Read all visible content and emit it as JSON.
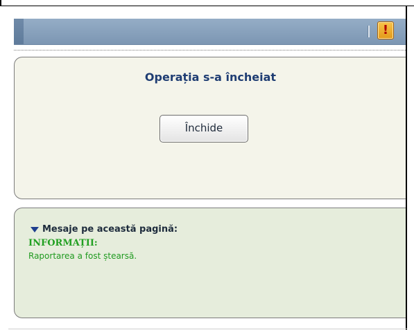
{
  "header": {
    "alert_icon": "exclamation-icon",
    "alert_glyph": "!"
  },
  "main": {
    "title": "Operația s-a încheiat",
    "close_button": "Închide"
  },
  "messages": {
    "heading": "Mesaje pe această pagină:",
    "category": "INFORMAȚII:",
    "text": "Raportarea a fost ștearsă."
  },
  "colors": {
    "header": "#7c96b3",
    "title": "#1f3d73",
    "info_green": "#22a022",
    "alert": "#e39a1a"
  }
}
